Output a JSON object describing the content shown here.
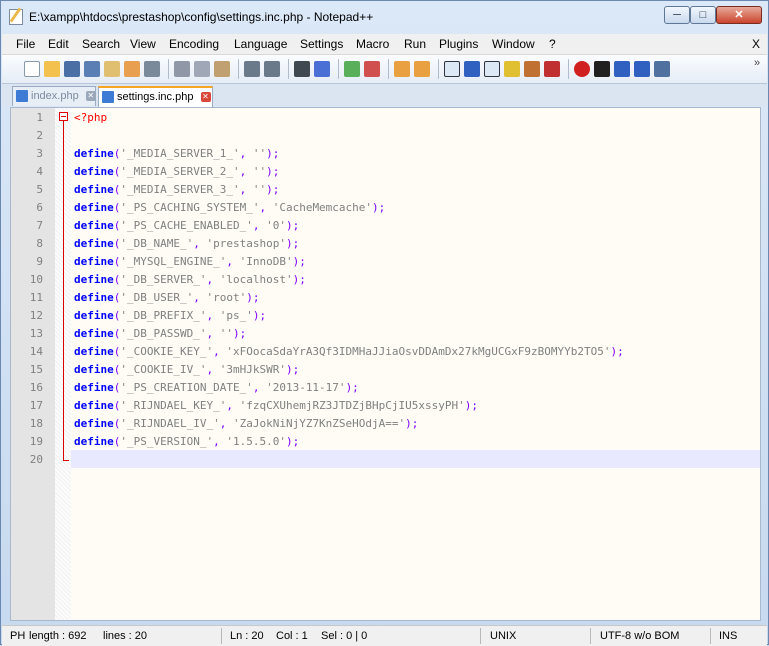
{
  "window": {
    "title": "E:\\xampp\\htdocs\\prestashop\\config\\settings.inc.php - Notepad++",
    "min_label": "─",
    "max_label": "□",
    "close_label": "✕"
  },
  "menu": {
    "items": [
      "File",
      "Edit",
      "Search",
      "View",
      "Encoding",
      "Language",
      "Settings",
      "Macro",
      "Run",
      "Plugins",
      "Window",
      "?"
    ],
    "close_label": "X"
  },
  "toolbar": {
    "icons": [
      "new-file-icon",
      "open-file-icon",
      "save-icon",
      "save-all-icon",
      "close-icon",
      "close-all-icon",
      "print-icon",
      "cut-icon",
      "copy-icon",
      "paste-icon",
      "undo-icon",
      "redo-icon",
      "find-icon",
      "replace-icon",
      "zoom-in-icon",
      "zoom-out-icon",
      "sync-vertical-icon",
      "sync-horizontal-icon",
      "word-wrap-icon",
      "show-all-characters-icon",
      "indent-guide-icon",
      "user-defined-language-icon",
      "document-map-icon",
      "function-list-icon",
      "record-macro-icon",
      "stop-recording-icon",
      "play-macro-icon",
      "run-macro-multiple-icon",
      "save-macro-icon"
    ],
    "overflow_label": "»"
  },
  "tabs": [
    {
      "label": "index.php",
      "active": false
    },
    {
      "label": "settings.inc.php",
      "active": true
    }
  ],
  "tab_close_label": "✕",
  "editor": {
    "line_numbers": [
      "1",
      "2",
      "3",
      "4",
      "5",
      "6",
      "7",
      "8",
      "9",
      "10",
      "11",
      "12",
      "13",
      "14",
      "15",
      "16",
      "17",
      "18",
      "19",
      "20"
    ],
    "php_open": "<?php",
    "keyword": "define",
    "lines": [
      {
        "key": "'_MEDIA_SERVER_1_'",
        "value": "''"
      },
      {
        "key": "'_MEDIA_SERVER_2_'",
        "value": "''"
      },
      {
        "key": "'_MEDIA_SERVER_3_'",
        "value": "''"
      },
      {
        "key": "'_PS_CACHING_SYSTEM_'",
        "value": "'CacheMemcache'"
      },
      {
        "key": "'_PS_CACHE_ENABLED_'",
        "value": "'0'"
      },
      {
        "key": "'_DB_NAME_'",
        "value": "'prestashop'"
      },
      {
        "key": "'_MYSQL_ENGINE_'",
        "value": "'InnoDB'"
      },
      {
        "key": "'_DB_SERVER_'",
        "value": "'localhost'"
      },
      {
        "key": "'_DB_USER_'",
        "value": "'root'"
      },
      {
        "key": "'_DB_PREFIX_'",
        "value": "'ps_'"
      },
      {
        "key": "'_DB_PASSWD_'",
        "value": "''"
      },
      {
        "key": "'_COOKIE_KEY_'",
        "value": "'xFOocaSdaYrA3Qf3IDMHaJJiaOsvDDAmDx27kMgUCGxF9zBOMYYb2TO5'"
      },
      {
        "key": "'_COOKIE_IV_'",
        "value": "'3mHJkSWR'"
      },
      {
        "key": "'_PS_CREATION_DATE_'",
        "value": "'2013-11-17'"
      },
      {
        "key": "'_RIJNDAEL_KEY_'",
        "value": "'fzqCXUhemjRZ3JTDZjBHpCjIU5xssyPH'"
      },
      {
        "key": "'_RIJNDAEL_IV_'",
        "value": "'ZaJokNiNjYZ7KnZSeHOdjA=='"
      },
      {
        "key": "'_PS_VERSION_'",
        "value": "'1.5.5.0'"
      }
    ],
    "open_paren": "(",
    "comma": ", ",
    "close": ");"
  },
  "status": {
    "file_type": "PH",
    "length": "length : 692",
    "lines": "lines : 20",
    "ln": "Ln : 20",
    "col": "Col : 1",
    "sel": "Sel : 0 | 0",
    "eol": "UNIX",
    "encoding": "UTF-8 w/o BOM",
    "mode": "INS"
  }
}
